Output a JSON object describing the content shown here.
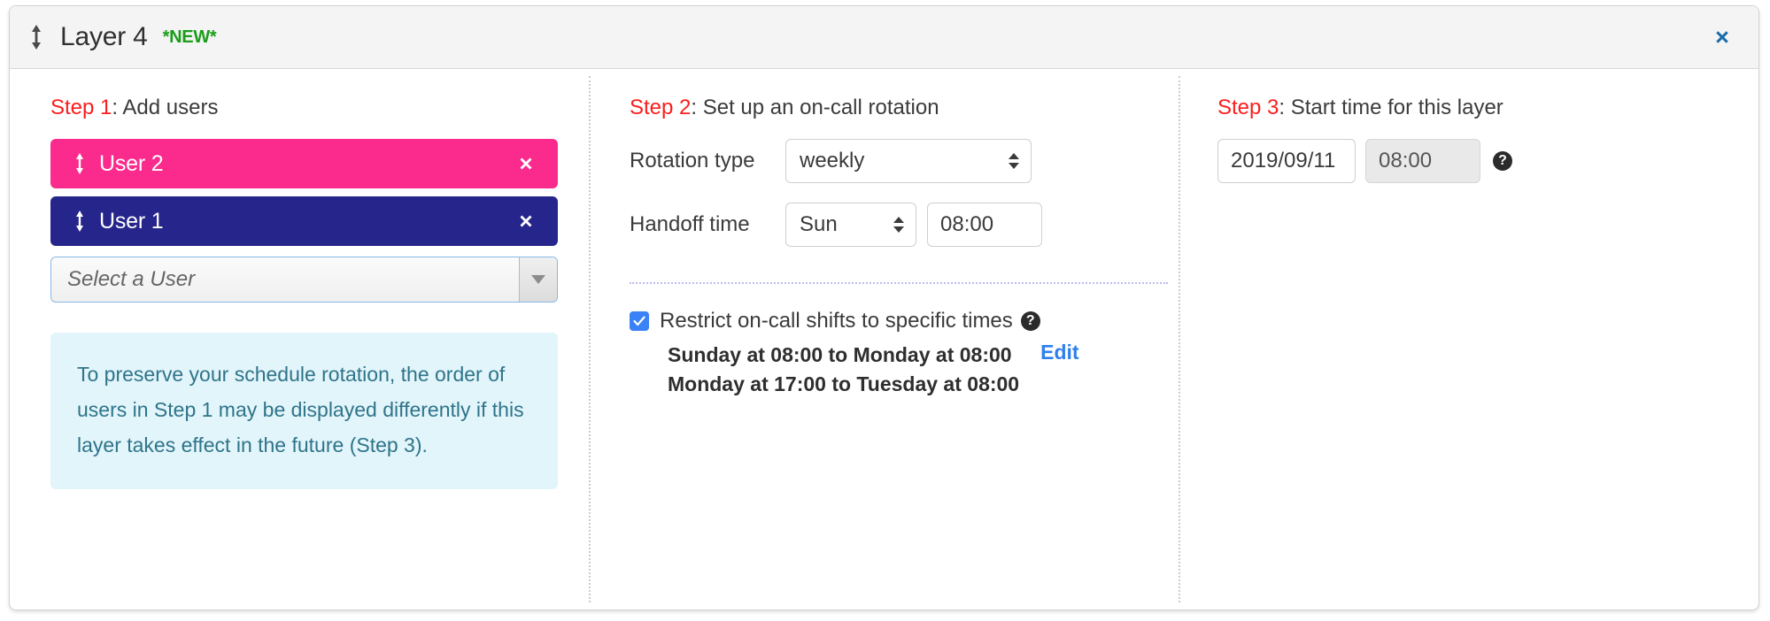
{
  "header": {
    "drag_handle_icon": "drag-vertical-icon",
    "title": "Layer 4",
    "new_badge": "*NEW*",
    "close_icon": "close-icon",
    "close_color": "#1a6ca8",
    "new_badge_color": "#1a9c1a"
  },
  "step1": {
    "step_label": "Step 1",
    "step_title": ": Add users",
    "users": [
      {
        "name": "User 2",
        "color": "#fb2a8d",
        "handle_icon": "drag-vertical-icon",
        "remove_icon": "remove-icon"
      },
      {
        "name": "User 1",
        "color": "#25258c",
        "handle_icon": "drag-vertical-icon",
        "remove_icon": "remove-icon"
      }
    ],
    "select_user_placeholder": "Select a User",
    "dropdown_icon": "chevron-down-icon",
    "info_text": "To preserve your schedule rotation, the order of users in Step 1 may be displayed differently if this layer takes effect in the future (Step 3).",
    "info_bg": "#e2f5fb",
    "info_color": "#2f7489"
  },
  "step2": {
    "step_label": "Step 2",
    "step_title": ": Set up an on-call rotation",
    "rotation_type_label": "Rotation type",
    "rotation_type_value": "weekly",
    "handoff_time_label": "Handoff time",
    "handoff_day_value": "Sun",
    "handoff_time_value": "08:00",
    "restrict_checkbox_checked": true,
    "restrict_label": "Restrict on-call shifts to specific times",
    "restrict_help_icon": "help-icon",
    "restrict_times_line1": "Sunday at 08:00 to Monday at 08:00",
    "restrict_times_line2": "Monday at 17:00 to Tuesday at 08:00",
    "edit_link": "Edit",
    "edit_link_color": "#2f80ed"
  },
  "step3": {
    "step_label": "Step 3",
    "step_title": ": Start time for this layer",
    "start_date_value": "2019/09/11",
    "start_time_value": "08:00",
    "help_icon": "help-icon"
  },
  "theme": {
    "step_number_color": "#fb1e1e",
    "header_bg": "#f4f4f4"
  }
}
